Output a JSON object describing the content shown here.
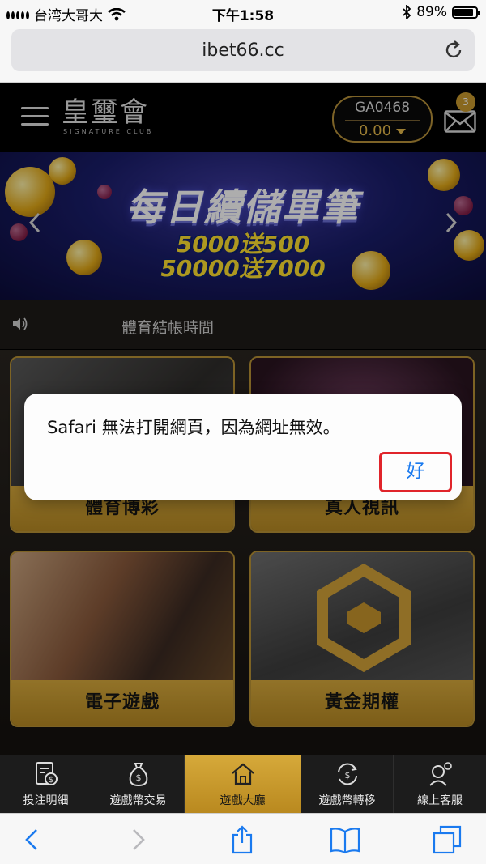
{
  "status_bar": {
    "carrier": "台湾大哥大",
    "time": "下午1:58",
    "battery": "89%",
    "battery_level": 0.89
  },
  "browser": {
    "url": "ibet66.cc"
  },
  "header": {
    "logo": "皇璽會",
    "logo_sub": "SIGNATURE CLUB",
    "account_id": "GA0468",
    "balance": "0.00",
    "mail_count": "3"
  },
  "banner": {
    "title": "每日續儲單筆",
    "line1": "5000送500",
    "line2": "50000送7000"
  },
  "marquee": {
    "text": "體育結帳時間"
  },
  "games": [
    {
      "label": "體育博彩"
    },
    {
      "label": "真人視訊"
    },
    {
      "label": "電子遊戲"
    },
    {
      "label": "黃金期權"
    }
  ],
  "alert": {
    "message": "Safari 無法打開網頁，因為網址無效。",
    "ok_label": "好"
  },
  "tabs": [
    {
      "label": "投注明細",
      "icon": "bet-record-icon"
    },
    {
      "label": "遊戲幣交易",
      "icon": "money-bag-icon"
    },
    {
      "label": "遊戲大廳",
      "icon": "home-icon",
      "active": true
    },
    {
      "label": "遊戲幣轉移",
      "icon": "transfer-icon"
    },
    {
      "label": "線上客服",
      "icon": "customer-service-icon"
    }
  ],
  "colors": {
    "gold": "#d6a93a",
    "alert_button": "#1a7aef",
    "highlight_border": "#e0242a"
  }
}
